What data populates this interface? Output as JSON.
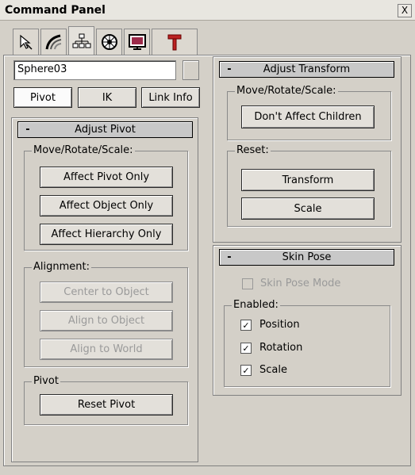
{
  "window": {
    "title": "Command Panel",
    "close_label": "X"
  },
  "tabs": [
    {
      "name": "create",
      "icon": "pointer-icon"
    },
    {
      "name": "modify",
      "icon": "curve-icon"
    },
    {
      "name": "hierarchy",
      "icon": "hierarchy-icon",
      "active": true
    },
    {
      "name": "motion",
      "icon": "wheel-icon"
    },
    {
      "name": "display",
      "icon": "monitor-icon"
    },
    {
      "name": "utilities",
      "icon": "hammer-icon"
    }
  ],
  "object": {
    "name": "Sphere03",
    "color": "#d4d0c8"
  },
  "mode_buttons": {
    "pivot": "Pivot",
    "ik": "IK",
    "link_info": "Link Info"
  },
  "adjust_pivot": {
    "header_minus": "-",
    "title": "Adjust Pivot",
    "move_group": "Move/Rotate/Scale:",
    "affect_pivot": "Affect Pivot Only",
    "affect_object": "Affect Object Only",
    "affect_hierarchy": "Affect Hierarchy Only",
    "alignment_group": "Alignment:",
    "center_to_object": "Center to Object",
    "align_to_object": "Align to Object",
    "align_to_world": "Align to World",
    "pivot_group": "Pivot",
    "reset_pivot": "Reset Pivot"
  },
  "adjust_transform": {
    "header_minus": "-",
    "title": "Adjust Transform",
    "move_group": "Move/Rotate/Scale:",
    "dont_affect_children": "Don't Affect Children",
    "reset_group": "Reset:",
    "transform": "Transform",
    "scale": "Scale"
  },
  "skin_pose": {
    "header_minus": "-",
    "title": "Skin Pose",
    "skin_pose_mode": "Skin Pose Mode",
    "enabled_group": "Enabled:",
    "position": "Position",
    "rotation": "Rotation",
    "scale": "Scale",
    "check": "✓"
  }
}
